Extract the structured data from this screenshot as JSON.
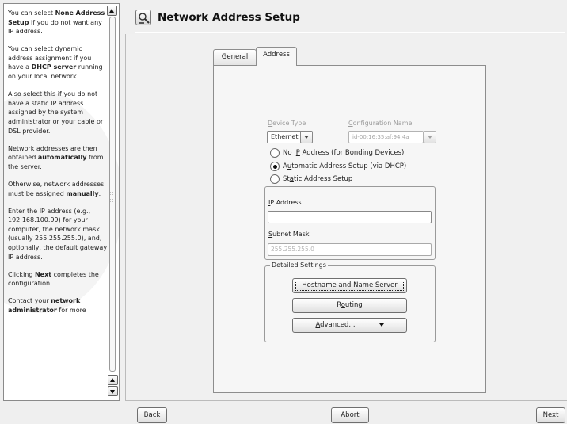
{
  "help": {
    "paragraphs": [
      [
        {
          "t": "You can select "
        },
        {
          "t": "None Address Setup",
          "b": true
        },
        {
          "t": " if you do not want any IP address."
        }
      ],
      [
        {
          "t": "You can select dynamic address assignment if you have a "
        },
        {
          "t": "DHCP server",
          "b": true
        },
        {
          "t": " running on your local network."
        }
      ],
      [
        {
          "t": "Also select this if you do not have a static IP address assigned by the system administrator or your cable or DSL provider."
        }
      ],
      [
        {
          "t": "Network addresses are then obtained "
        },
        {
          "t": "automatically",
          "b": true
        },
        {
          "t": " from the server."
        }
      ],
      [
        {
          "t": "Otherwise, network addresses must be assigned "
        },
        {
          "t": "manually",
          "b": true
        },
        {
          "t": "."
        }
      ],
      [
        {
          "t": "Enter the IP address (e.g., 192.168.100.99) for your computer, the network mask (usually 255.255.255.0), and, optionally, the default gateway IP address."
        }
      ],
      [
        {
          "t": "Clicking "
        },
        {
          "t": "Next",
          "b": true
        },
        {
          "t": " completes the configuration."
        }
      ],
      [
        {
          "t": "Contact your "
        },
        {
          "t": "network administrator",
          "b": true
        },
        {
          "t": " for more"
        }
      ]
    ]
  },
  "header": {
    "title": "Network Address Setup",
    "icon": "network-config-icon"
  },
  "tabs": {
    "general": "General",
    "address": "Address",
    "active": "Address"
  },
  "form": {
    "device_type_label": "Device Type",
    "device_type_value": "Ethernet",
    "config_name_label": "Configuration Name",
    "config_name_value": "id-00:16:35:af:94:4a",
    "radios": [
      {
        "pre": "No I",
        "acc": "P",
        "post": " Address (for Bonding Devices)",
        "selected": false
      },
      {
        "pre": "A",
        "acc": "u",
        "post": "tomatic Address Setup (via DHCP)",
        "selected": true
      },
      {
        "pre": "St",
        "acc": "a",
        "post": "tic Address Setup",
        "selected": false
      }
    ],
    "ip_label_acc": "I",
    "ip_label_rest": "P Address",
    "ip_value": "",
    "mask_label_acc": "S",
    "mask_label_rest": "ubnet Mask",
    "mask_value": "255.255.255.0",
    "detailed_settings_label": "Detailed Settings",
    "hostname_btn": {
      "acc": "H",
      "rest": "ostname and Name Server"
    },
    "routing_btn": {
      "pre": "R",
      "acc": "o",
      "post": "uting"
    },
    "advanced_btn": {
      "acc": "A",
      "rest": "dvanced..."
    }
  },
  "nav": {
    "back": {
      "acc": "B",
      "rest": "ack"
    },
    "abort": {
      "pre": "Abo",
      "acc": "r",
      "post": "t"
    },
    "next": {
      "acc": "N",
      "rest": "ext"
    }
  }
}
